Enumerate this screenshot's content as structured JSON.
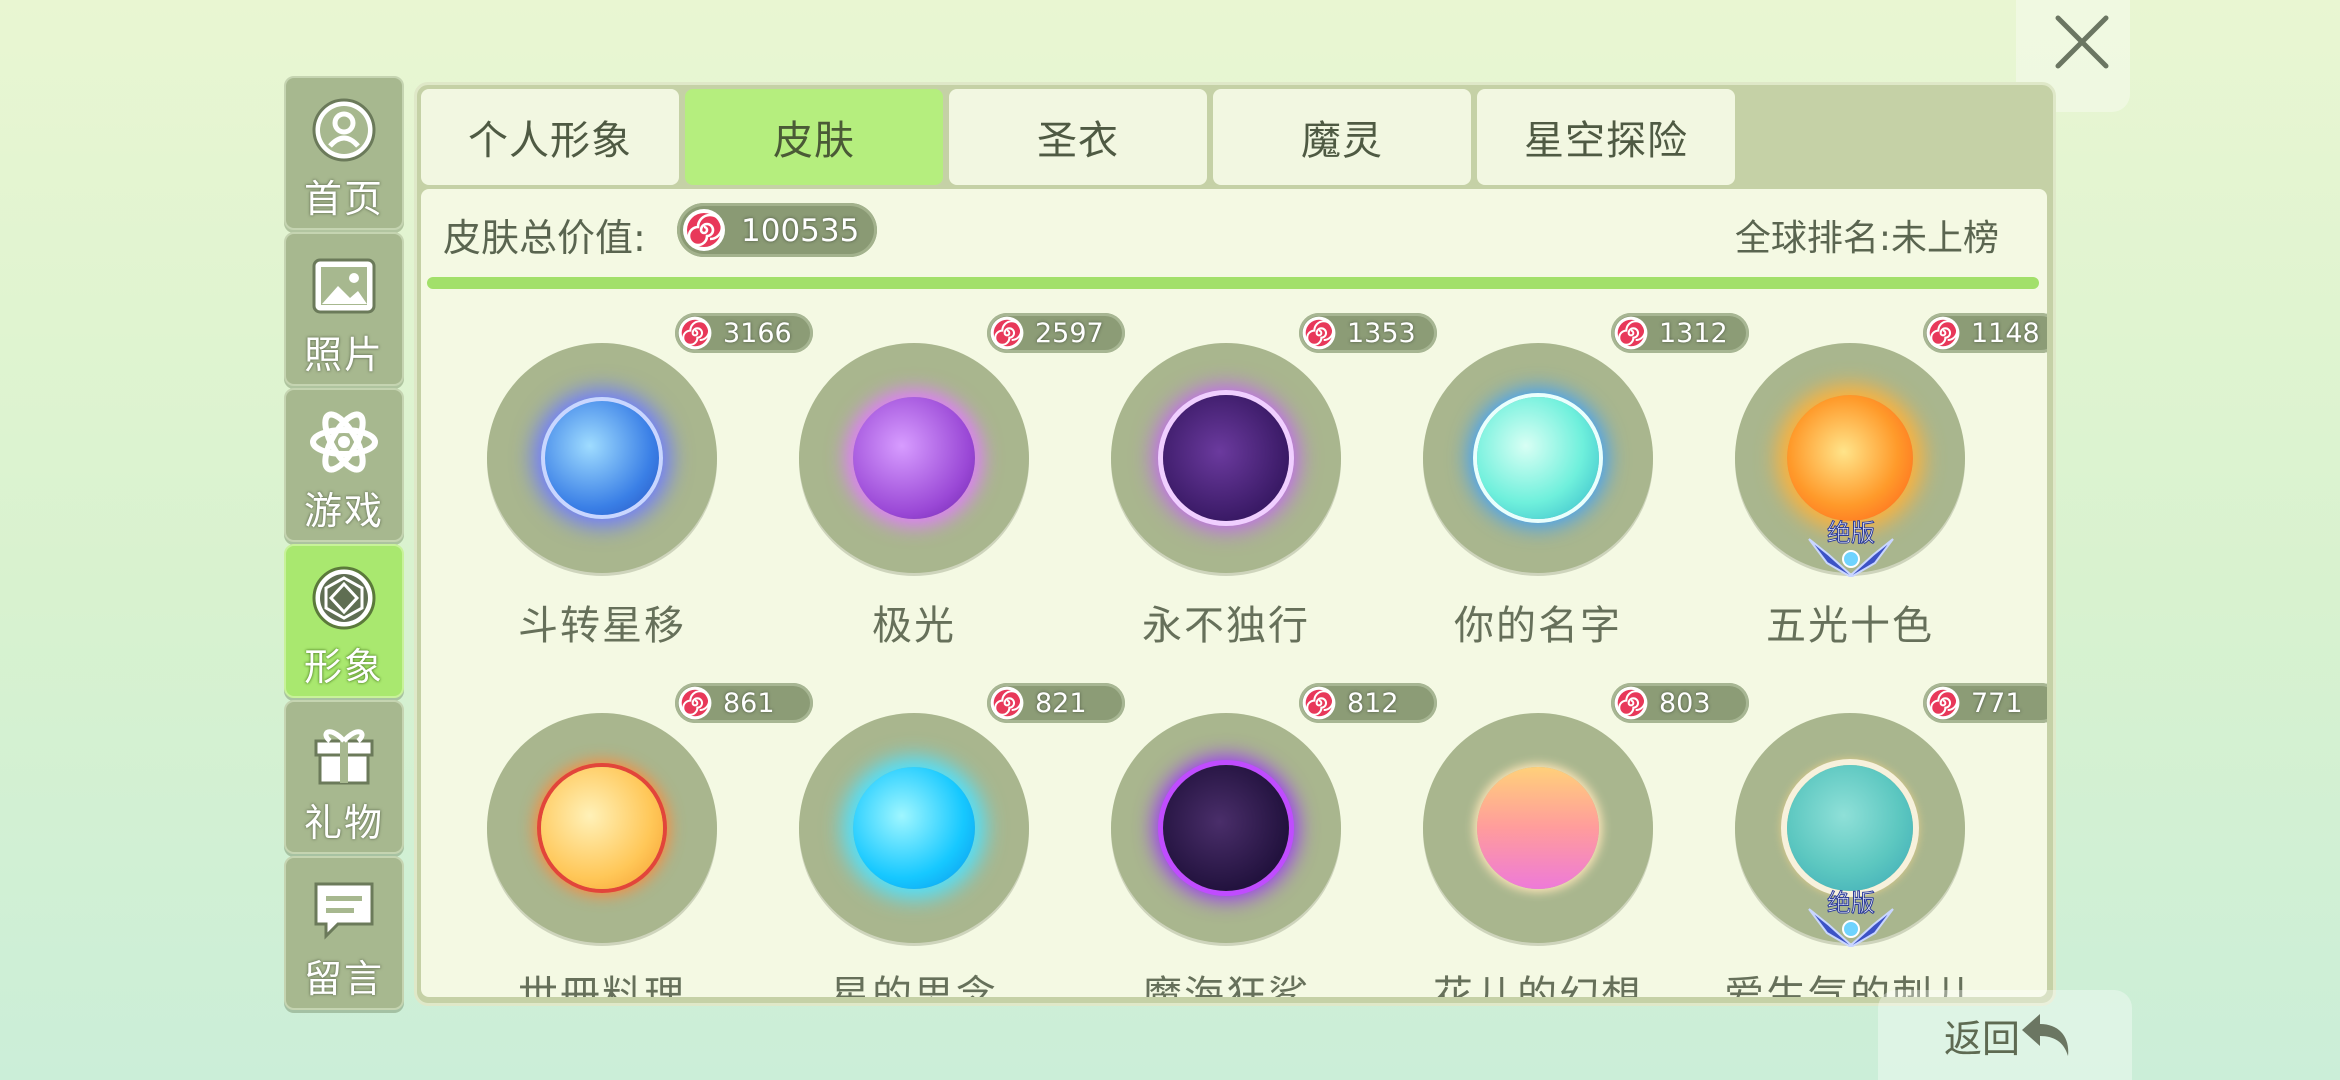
{
  "sidebar": {
    "items": [
      {
        "label": "首页",
        "icon": "home-icon"
      },
      {
        "label": "照片",
        "icon": "photo-icon"
      },
      {
        "label": "游戏",
        "icon": "atom-icon"
      },
      {
        "label": "形象",
        "icon": "avatar-icon",
        "active": true
      },
      {
        "label": "礼物",
        "icon": "gift-icon"
      },
      {
        "label": "留言",
        "icon": "message-icon"
      }
    ]
  },
  "tabs": [
    {
      "label": "个人形象"
    },
    {
      "label": "皮肤",
      "active": true
    },
    {
      "label": "圣衣"
    },
    {
      "label": "魔灵"
    },
    {
      "label": "星空探险"
    }
  ],
  "summary": {
    "total_label": "皮肤总价值:",
    "total_value": "100535",
    "rank_text": "全球排名:未上榜"
  },
  "skins": [
    {
      "name": "斗转星移",
      "price": "3166"
    },
    {
      "name": "极光",
      "price": "2597"
    },
    {
      "name": "永不独行",
      "price": "1353"
    },
    {
      "name": "你的名字",
      "price": "1312"
    },
    {
      "name": "五光十色",
      "price": "1148",
      "badge": "绝版"
    },
    {
      "name": "世冊料理",
      "price": "861"
    },
    {
      "name": "星的思念",
      "price": "821"
    },
    {
      "name": "魔海狂鲨",
      "price": "812"
    },
    {
      "name": "花儿的幻想",
      "price": "803"
    },
    {
      "name": "爱生气的刺儿",
      "price": "771",
      "badge": "绝版"
    }
  ],
  "footer": {
    "back_label": "返回"
  },
  "colors": {
    "accent_green": "#b5ee7e",
    "panel": "#c5d1a6",
    "disc": "#a9b68e",
    "coin_red": "#e8385a"
  }
}
